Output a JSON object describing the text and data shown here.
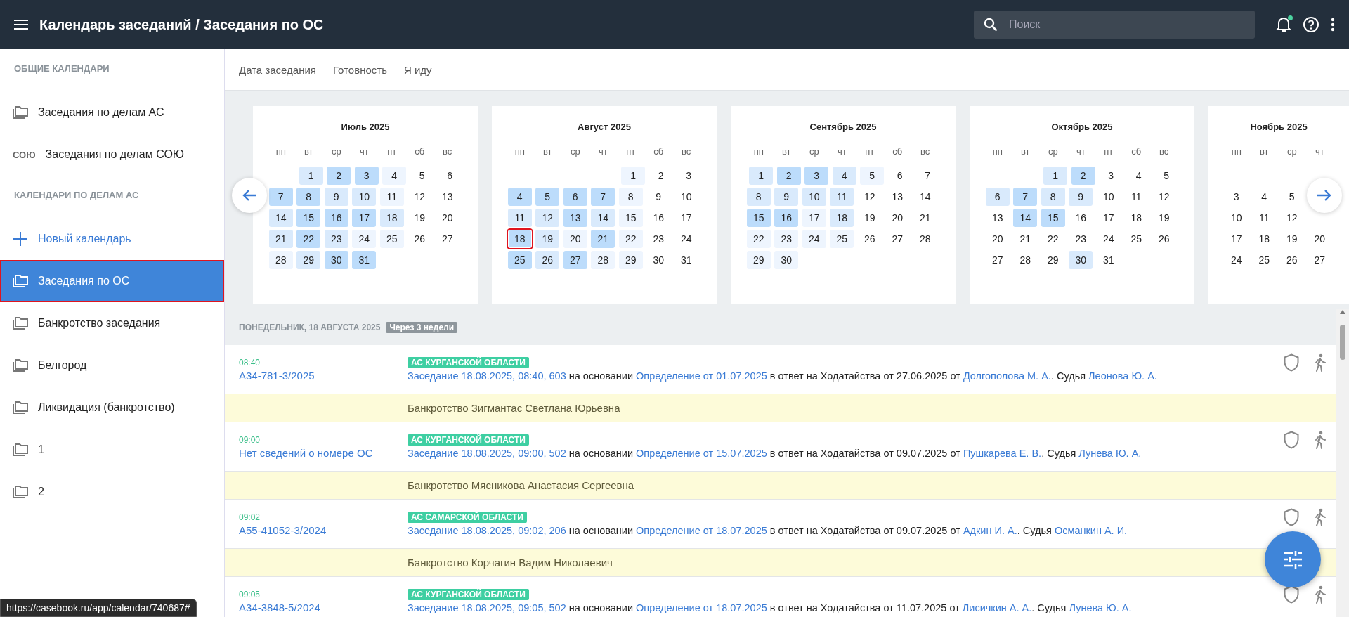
{
  "topbar": {
    "title": "Календарь заседаний / Заседания по ОС",
    "search": {
      "placeholder": "Поиск"
    },
    "notifications_unread": true
  },
  "sidebar": {
    "sections": [
      {
        "heading": "ОБЩИЕ КАЛЕНДАРИ",
        "items": [
          {
            "kind": "folder",
            "label": "Заседания по делам АС",
            "selected": false
          },
          {
            "kind": "text_icon",
            "icon_text": "СОЮ",
            "label": "Заседания по делам СОЮ",
            "selected": false
          }
        ]
      },
      {
        "heading": "КАЛЕНДАРИ ПО ДЕЛАМ АС",
        "items": [
          {
            "kind": "add",
            "label": "Новый календарь",
            "selected": false
          },
          {
            "kind": "folder",
            "label": "Заседания по ОС",
            "selected": true
          },
          {
            "kind": "folder",
            "label": "Банкротство заседания",
            "selected": false
          },
          {
            "kind": "folder",
            "label": "Белгород",
            "selected": false
          },
          {
            "kind": "folder",
            "label": "Ликвидация (банкротство)",
            "selected": false
          },
          {
            "kind": "folder",
            "label": "1",
            "selected": false
          },
          {
            "kind": "folder",
            "label": "2",
            "selected": false
          }
        ]
      }
    ]
  },
  "tabs": [
    {
      "label": "Дата заседания"
    },
    {
      "label": "Готовность"
    },
    {
      "label": "Я иду"
    }
  ],
  "calendar": {
    "months": [
      {
        "title": "Июль 2025",
        "weekdays": [
          "пн",
          "вт",
          "ср",
          "чт",
          "пт",
          "сб",
          "вс"
        ],
        "first_row_empty": false,
        "weeks": [
          [
            {
              "d": "1",
              "color": "#d9eafc"
            },
            {
              "d": "2",
              "color": "#bcdcfb"
            },
            {
              "d": "3",
              "color": "#bcdcfb"
            },
            {
              "d": "4",
              "color": "#eef5fe"
            },
            {
              "d": "5"
            },
            {
              "d": "6"
            }
          ],
          [
            {
              "d": "7",
              "color": "#bcdcfb"
            },
            {
              "d": "8",
              "color": "#bcdcfb"
            },
            {
              "d": "9",
              "color": "#d9eafc"
            },
            {
              "d": "10",
              "color": "#d9eafc"
            },
            {
              "d": "11",
              "color": "#eef5fe"
            },
            {
              "d": "12"
            },
            {
              "d": "13"
            }
          ],
          [
            {
              "d": "14",
              "color": "#d9eafc"
            },
            {
              "d": "15",
              "color": "#bcdcfb"
            },
            {
              "d": "16",
              "color": "#bcdcfb"
            },
            {
              "d": "17",
              "color": "#bcdcfb"
            },
            {
              "d": "18",
              "color": "#d9eafc"
            },
            {
              "d": "19"
            },
            {
              "d": "20"
            }
          ],
          [
            {
              "d": "21",
              "color": "#d9eafc"
            },
            {
              "d": "22",
              "color": "#bcdcfb"
            },
            {
              "d": "23",
              "color": "#d9eafc"
            },
            {
              "d": "24",
              "color": "#eef5fe"
            },
            {
              "d": "25",
              "color": "#eef5fe"
            },
            {
              "d": "26"
            },
            {
              "d": "27"
            }
          ],
          [
            {
              "d": "28",
              "color": "#eef5fe"
            },
            {
              "d": "29",
              "color": "#d9eafc"
            },
            {
              "d": "30",
              "color": "#bcdcfb"
            },
            {
              "d": "31",
              "color": "#bcdcfb"
            }
          ]
        ]
      },
      {
        "title": "Август 2025",
        "weekdays": [
          "пн",
          "вт",
          "ср",
          "чт",
          "пт",
          "сб",
          "вс"
        ],
        "first_row_empty": false,
        "weeks": [
          [
            {
              "d": "1",
              "color": "#eef5fe"
            },
            {
              "d": "2"
            },
            {
              "d": "3"
            }
          ],
          [
            {
              "d": "4",
              "color": "#bcdcfb"
            },
            {
              "d": "5",
              "color": "#bcdcfb"
            },
            {
              "d": "6",
              "color": "#bcdcfb"
            },
            {
              "d": "7",
              "color": "#bcdcfb"
            },
            {
              "d": "8",
              "color": "#eef5fe"
            },
            {
              "d": "9"
            },
            {
              "d": "10"
            }
          ],
          [
            {
              "d": "11",
              "color": "#d9eafc"
            },
            {
              "d": "12",
              "color": "#d9eafc"
            },
            {
              "d": "13",
              "color": "#bcdcfb"
            },
            {
              "d": "14",
              "color": "#d9eafc"
            },
            {
              "d": "15",
              "color": "#eef5fe"
            },
            {
              "d": "16"
            },
            {
              "d": "17"
            }
          ],
          [
            {
              "d": "18",
              "color": "#bcdcfb",
              "today": true
            },
            {
              "d": "19",
              "color": "#d9eafc"
            },
            {
              "d": "20",
              "color": "#eef5fe"
            },
            {
              "d": "21",
              "color": "#bcdcfb"
            },
            {
              "d": "22",
              "color": "#eef5fe"
            },
            {
              "d": "23"
            },
            {
              "d": "24"
            }
          ],
          [
            {
              "d": "25",
              "color": "#bcdcfb"
            },
            {
              "d": "26",
              "color": "#d9eafc"
            },
            {
              "d": "27",
              "color": "#bcdcfb"
            },
            {
              "d": "28",
              "color": "#eef5fe"
            },
            {
              "d": "29",
              "color": "#eef5fe"
            },
            {
              "d": "30"
            },
            {
              "d": "31"
            }
          ]
        ]
      },
      {
        "title": "Сентябрь 2025",
        "weekdays": [
          "пн",
          "вт",
          "ср",
          "чт",
          "пт",
          "сб",
          "вс"
        ],
        "first_row_empty": false,
        "weeks": [
          [
            {
              "d": "1",
              "color": "#d9eafc"
            },
            {
              "d": "2",
              "color": "#bcdcfb"
            },
            {
              "d": "3",
              "color": "#bcdcfb"
            },
            {
              "d": "4",
              "color": "#d9eafc"
            },
            {
              "d": "5",
              "color": "#eef5fe"
            },
            {
              "d": "6"
            },
            {
              "d": "7"
            }
          ],
          [
            {
              "d": "8",
              "color": "#d9eafc"
            },
            {
              "d": "9",
              "color": "#d9eafc"
            },
            {
              "d": "10",
              "color": "#d9eafc"
            },
            {
              "d": "11",
              "color": "#d9eafc"
            },
            {
              "d": "12"
            },
            {
              "d": "13"
            },
            {
              "d": "14"
            }
          ],
          [
            {
              "d": "15",
              "color": "#bcdcfb"
            },
            {
              "d": "16",
              "color": "#bcdcfb"
            },
            {
              "d": "17",
              "color": "#eef5fe"
            },
            {
              "d": "18",
              "color": "#d9eafc"
            },
            {
              "d": "19"
            },
            {
              "d": "20"
            },
            {
              "d": "21"
            }
          ],
          [
            {
              "d": "22",
              "color": "#eef5fe"
            },
            {
              "d": "23",
              "color": "#eef5fe"
            },
            {
              "d": "24",
              "color": "#eef5fe"
            },
            {
              "d": "25",
              "color": "#eef5fe"
            },
            {
              "d": "26"
            },
            {
              "d": "27"
            },
            {
              "d": "28"
            }
          ],
          [
            {
              "d": "29",
              "color": "#eef5fe"
            },
            {
              "d": "30",
              "color": "#eef5fe"
            }
          ]
        ]
      },
      {
        "title": "Октябрь 2025",
        "weekdays": [
          "пн",
          "вт",
          "ср",
          "чт",
          "пт",
          "сб",
          "вс"
        ],
        "first_row_empty": false,
        "weeks": [
          [
            {
              "d": "1",
              "color": "#d9eafc"
            },
            {
              "d": "2",
              "color": "#bcdcfb"
            },
            {
              "d": "3"
            },
            {
              "d": "4"
            },
            {
              "d": "5"
            }
          ],
          [
            {
              "d": "6",
              "color": "#d9eafc"
            },
            {
              "d": "7",
              "color": "#bcdcfb"
            },
            {
              "d": "8",
              "color": "#d9eafc"
            },
            {
              "d": "9",
              "color": "#d9eafc"
            },
            {
              "d": "10"
            },
            {
              "d": "11"
            },
            {
              "d": "12"
            }
          ],
          [
            {
              "d": "13"
            },
            {
              "d": "14",
              "color": "#bcdcfb"
            },
            {
              "d": "15",
              "color": "#bcdcfb"
            },
            {
              "d": "16"
            },
            {
              "d": "17"
            },
            {
              "d": "18"
            },
            {
              "d": "19"
            }
          ],
          [
            {
              "d": "20"
            },
            {
              "d": "21"
            },
            {
              "d": "22"
            },
            {
              "d": "23"
            },
            {
              "d": "24"
            },
            {
              "d": "25"
            },
            {
              "d": "26"
            }
          ],
          [
            {
              "d": "27"
            },
            {
              "d": "28"
            },
            {
              "d": "29"
            },
            {
              "d": "30",
              "color": "#d9eafc"
            },
            {
              "d": "31"
            }
          ]
        ]
      },
      {
        "title": "Ноябрь 2025",
        "weekdays": [
          "пн",
          "вт",
          "ср",
          "чт"
        ],
        "first_row_empty": true,
        "weeks": [
          [
            {
              "d": "3"
            },
            {
              "d": "4"
            },
            {
              "d": "5"
            }
          ],
          [
            {
              "d": "10"
            },
            {
              "d": "11"
            },
            {
              "d": "12"
            }
          ],
          [
            {
              "d": "17"
            },
            {
              "d": "18"
            },
            {
              "d": "19"
            },
            {
              "d": "20"
            }
          ],
          [
            {
              "d": "24"
            },
            {
              "d": "25"
            },
            {
              "d": "26"
            },
            {
              "d": "27"
            }
          ]
        ]
      }
    ]
  },
  "day_header": {
    "date": "ПОНЕДЕЛЬНИК, 18 АВГУСТА 2025",
    "badge": "Через 3 недели"
  },
  "events": [
    {
      "time": "08:40",
      "case": "А34-781-3/2025",
      "court": "АС КУРГАНСКОЙ ОБЛАСТИ",
      "parts": [
        {
          "text": "Заседание 18.08.2025, 08:40, 603",
          "link": true
        },
        {
          "text": " на основании ",
          "link": false
        },
        {
          "text": "Определение от 01.07.2025",
          "link": true
        },
        {
          "text": " в ответ на Ходатайства от 27.06.2025 от ",
          "link": false
        },
        {
          "text": "Долгополова М. А.",
          "link": true
        },
        {
          "text": ". Судья ",
          "link": false
        },
        {
          "text": "Леонова Ю. А.",
          "link": true
        }
      ],
      "note": "Банкротство Зигмантас Светлана Юрьевна"
    },
    {
      "time": "09:00",
      "case": "Нет сведений о номере ОС",
      "court": "АС КУРГАНСКОЙ ОБЛАСТИ",
      "parts": [
        {
          "text": "Заседание 18.08.2025, 09:00, 502",
          "link": true
        },
        {
          "text": " на основании ",
          "link": false
        },
        {
          "text": "Определение от 15.07.2025",
          "link": true
        },
        {
          "text": " в ответ на Ходатайства от 09.07.2025 от ",
          "link": false
        },
        {
          "text": "Пушкарева Е. В.",
          "link": true
        },
        {
          "text": ". Судья ",
          "link": false
        },
        {
          "text": "Лунева Ю. А.",
          "link": true
        }
      ],
      "note": "Банкротство Мясникова Анастасия Сергеевна"
    },
    {
      "time": "09:02",
      "case": "А55-41052-3/2024",
      "court": "АС САМАРСКОЙ ОБЛАСТИ",
      "parts": [
        {
          "text": "Заседание 18.08.2025, 09:02, 206",
          "link": true
        },
        {
          "text": " на основании ",
          "link": false
        },
        {
          "text": "Определение от 18.07.2025",
          "link": true
        },
        {
          "text": " в ответ на Ходатайства от 09.07.2025 от ",
          "link": false
        },
        {
          "text": "Адкин И. А.",
          "link": true
        },
        {
          "text": ". Судья ",
          "link": false
        },
        {
          "text": "Османкин А. И.",
          "link": true
        }
      ],
      "note": "Банкротство Корчагин Вадим Николаевич"
    },
    {
      "time": "09:05",
      "case": "А34-3848-5/2024",
      "court": "АС КУРГАНСКОЙ ОБЛАСТИ",
      "parts": [
        {
          "text": "Заседание 18.08.2025, 09:05, 502",
          "link": true
        },
        {
          "text": " на основании ",
          "link": false
        },
        {
          "text": "Определение от 18.07.2025",
          "link": true
        },
        {
          "text": " в ответ на Ходатайства от 11.07.2025 от ",
          "link": false
        },
        {
          "text": "Лисичкин А. А.",
          "link": true
        },
        {
          "text": ". Судья ",
          "link": false
        },
        {
          "text": "Лунева Ю. А.",
          "link": true
        }
      ]
    }
  ],
  "status_url": "https://casebook.ru/app/calendar/740687#"
}
